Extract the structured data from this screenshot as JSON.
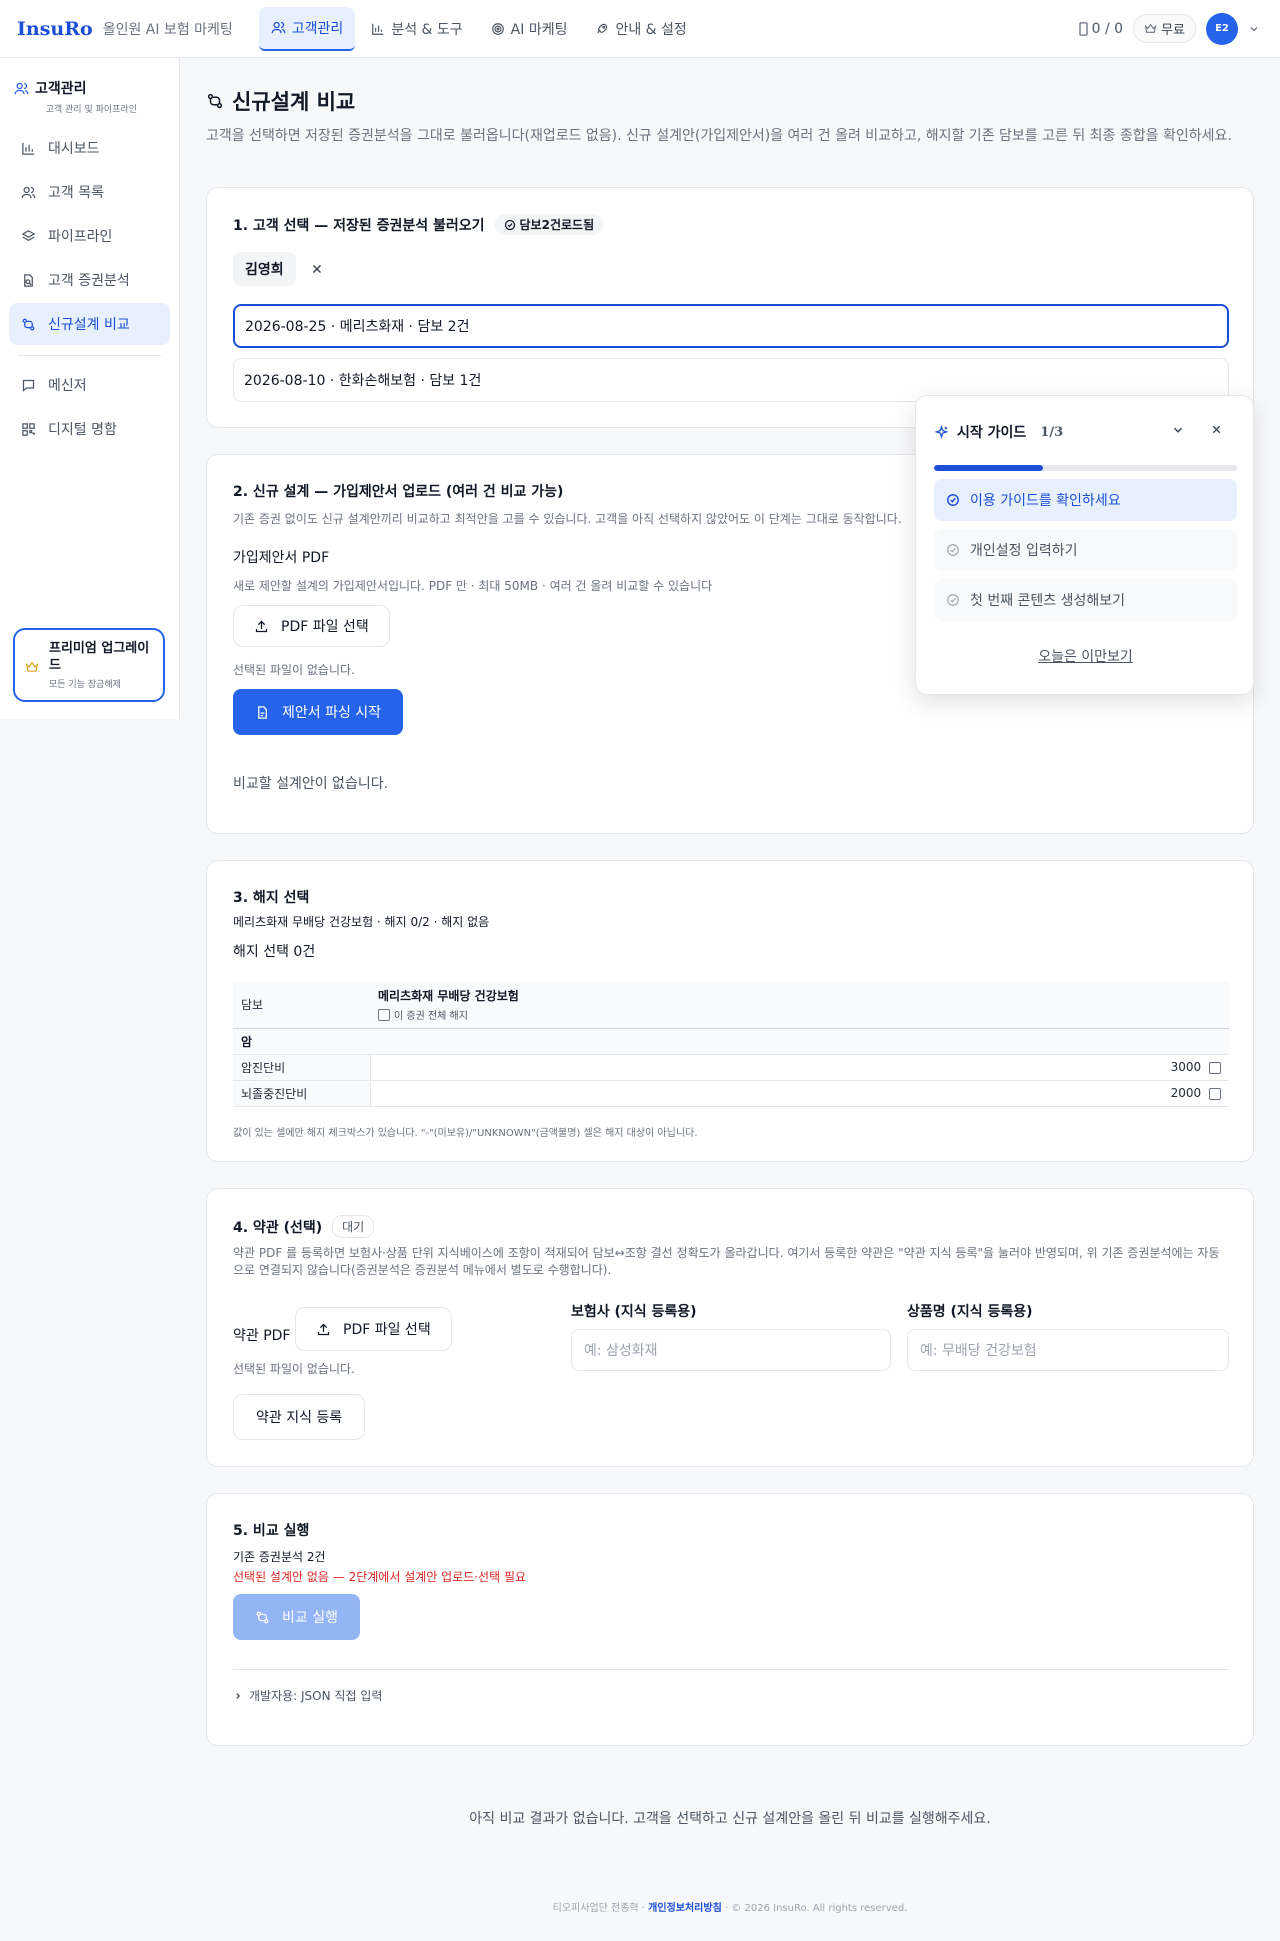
{
  "nav": {
    "logo": "InsuRo",
    "tagline": "올인원 AI 보험 마케팅",
    "tabs": [
      "고객관리",
      "분석 & 도구",
      "AI 마케팅",
      "안내 & 설정"
    ],
    "credits": "0 / 0",
    "plan": "무료",
    "avatar": "E2"
  },
  "sidebar": {
    "title": "고객관리",
    "subtitle": "고객 관리 및 파이프라인",
    "items": [
      "대시보드",
      "고객 목록",
      "파이프라인",
      "고객 증권분석",
      "신규설계 비교"
    ],
    "items2": [
      "메신저",
      "디지털 명함"
    ],
    "premium": {
      "title": "프리미엄 업그레이드",
      "sub": "모든 기능 잠금해제"
    }
  },
  "page": {
    "title": "신규설계 비교",
    "desc": "고객을 선택하면 저장된 증권분석을 그대로 불러옵니다(재업로드 없음). 신규 설계안(가입제안서)을 여러 건 올려 비교하고, 해지할 기존 담보를 고른 뒤 최종 종합을 확인하세요."
  },
  "s1": {
    "title": "1. 고객 선택 — 저장된 증권분석 불러오기",
    "badge": "담보2건로드됨",
    "customer": "김영희",
    "policies": [
      "2026-08-25 · 메리츠화재 · 담보 2건",
      "2026-08-10 · 한화손해보험 · 담보 1건"
    ]
  },
  "s2": {
    "title": "2. 신규 설계 — 가입제안서 업로드 (여러 건 비교 가능)",
    "desc": "기존 증권 없이도 신규 설계안끼리 비교하고 최적안을 고를 수 있습니다. 고객을 아직 선택하지 않았어도 이 단계는 그대로 동작합니다.",
    "pdf_label": "가입제안서 PDF",
    "pdf_desc": "새로 제안할 설계의 가입제안서입니다. PDF 만 · 최대 50MB · 여러 건 올려 비교할 수 있습니다",
    "file_btn": "PDF 파일 선택",
    "no_file": "선택된 파일이 없습니다.",
    "parse_btn": "제안서 파싱 시작",
    "empty": "비교할 설계안이 없습니다."
  },
  "s3": {
    "title": "3. 해지 선택",
    "summary": "메리츠화재 무배당 건강보험 · 해지 0/2 · 해지 없음",
    "count": "해지 선택 0건",
    "col_label": "담보",
    "col_policy": "메리츠화재 무배당 건강보험",
    "all_cancel": "이 증권 전체 해지",
    "group": "암",
    "rows": [
      {
        "name": "암진단비",
        "value": "3000"
      },
      {
        "name": "뇌졸중진단비",
        "value": "2000"
      }
    ],
    "note": "값이 있는 셀에만 해지 체크박스가 있습니다. \"-\"(미보유)/\"UNKNOWN\"(금액불명) 셀은 해지 대상이 아닙니다."
  },
  "s4": {
    "title": "4. 약관 (선택)",
    "badge": "대기",
    "desc": "약관 PDF 를 등록하면 보험사·상품 단위 지식베이스에 조항이 적재되어 담보↔조항 결선 정확도가 올라갑니다. 여기서 등록한 약관은 \"약관 지식 등록\"을 눌러야 반영되며, 위 기존 증권분석에는 자동으로 연결되지 않습니다(증권분석은 증권분석 메뉴에서 별도로 수행합니다).",
    "pdf_label": "약관 PDF",
    "file_btn": "PDF 파일 선택",
    "no_file": "선택된 파일이 없습니다.",
    "insurer_label": "보험사 (지식 등록용)",
    "insurer_placeholder": "예: 삼성화재",
    "product_label": "상품명 (지식 등록용)",
    "product_placeholder": "예: 무배당 건강보험",
    "register_btn": "약관 지식 등록"
  },
  "s5": {
    "title": "5. 비교 실행",
    "existing": "기존 증권분석 2건",
    "warning": "선택된 설계안 없음 — 2단계에서 설계안 업로드·선택 필요",
    "run_btn": "비교 실행",
    "dev": "개발자용: JSON 직접 입력"
  },
  "guide": {
    "title": "시작 가이드",
    "step": "1/3",
    "progress": 0.36,
    "items": [
      "이용 가이드를 확인하세요",
      "개인설정 입력하기",
      "첫 번째 콘텐츠 생성해보기"
    ],
    "skip": "오늘은 이만보기"
  },
  "footer": {
    "note": "아직 비교 결과가 없습니다. 고객을 선택하고 신규 설계안을 올린 뒤 비교를 실행해주세요.",
    "company": "티오피사업단 전종혁",
    "privacy": "개인정보처리방침",
    "copyright": "© 2026 InsuRo. All rights reserved."
  },
  "colors": {
    "accent": "#2563eb",
    "warning": "#dc2626"
  }
}
